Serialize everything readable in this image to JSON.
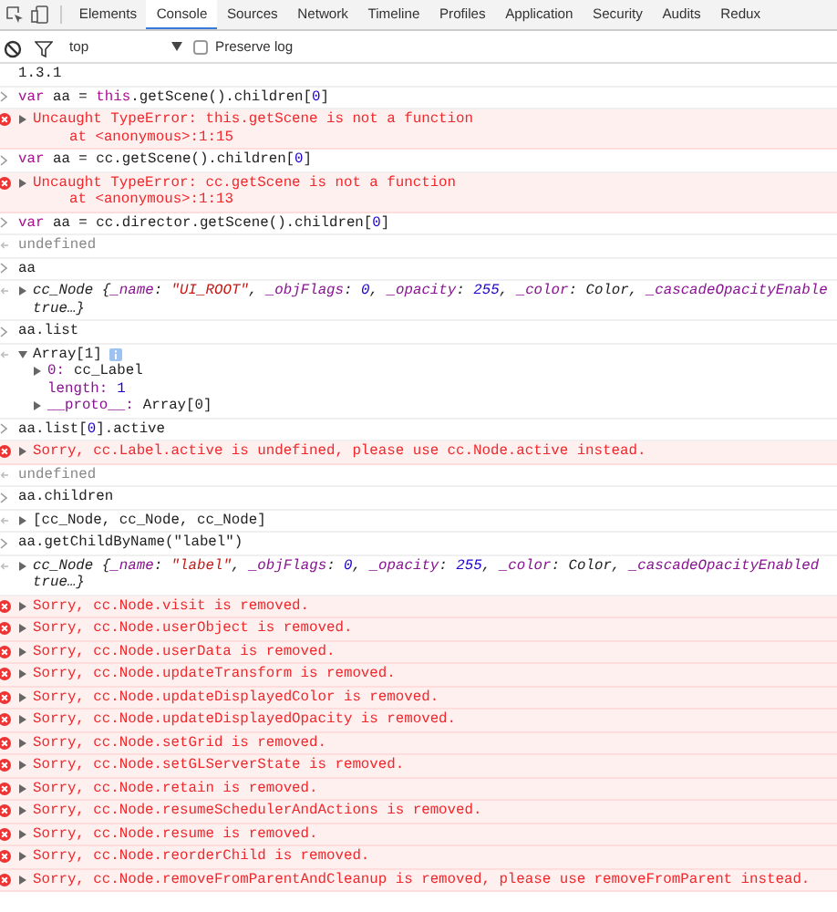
{
  "tabs": [
    {
      "label": "Elements",
      "selected": false
    },
    {
      "label": "Console",
      "selected": true
    },
    {
      "label": "Sources",
      "selected": false
    },
    {
      "label": "Network",
      "selected": false
    },
    {
      "label": "Timeline",
      "selected": false
    },
    {
      "label": "Profiles",
      "selected": false
    },
    {
      "label": "Application",
      "selected": false
    },
    {
      "label": "Security",
      "selected": false
    },
    {
      "label": "Audits",
      "selected": false
    },
    {
      "label": "Redux",
      "selected": false
    }
  ],
  "filter_bar": {
    "context": "top",
    "preserve_log": {
      "label": "Preserve log",
      "checked": false
    }
  },
  "console": [
    {
      "kind": "log",
      "text": "1.3.1"
    },
    {
      "kind": "input",
      "tokens": [
        {
          "kind": "keyword",
          "text": "var"
        },
        {
          "kind": "plain",
          "text": " aa = "
        },
        {
          "kind": "keyword",
          "text": "this"
        },
        {
          "kind": "plain",
          "text": ".getScene().children["
        },
        {
          "kind": "number",
          "text": "0"
        },
        {
          "kind": "plain",
          "text": "]"
        }
      ]
    },
    {
      "kind": "error",
      "expandable": true,
      "text": "Uncaught TypeError: this.getScene is not a function",
      "detail": "at <anonymous>:1:15"
    },
    {
      "kind": "input",
      "tokens": [
        {
          "kind": "keyword",
          "text": "var"
        },
        {
          "kind": "plain",
          "text": " aa = cc.getScene().children["
        },
        {
          "kind": "number",
          "text": "0"
        },
        {
          "kind": "plain",
          "text": "]"
        }
      ]
    },
    {
      "kind": "error",
      "expandable": true,
      "text": "Uncaught TypeError: cc.getScene is not a function",
      "detail": "at <anonymous>:1:13"
    },
    {
      "kind": "input",
      "tokens": [
        {
          "kind": "keyword",
          "text": "var"
        },
        {
          "kind": "plain",
          "text": " aa = cc.director.getScene().children["
        },
        {
          "kind": "number",
          "text": "0"
        },
        {
          "kind": "plain",
          "text": "]"
        }
      ]
    },
    {
      "kind": "output",
      "expandable": false,
      "text": "undefined"
    },
    {
      "kind": "input",
      "tokens": [
        {
          "kind": "plain",
          "text": "aa"
        }
      ]
    },
    {
      "kind": "object",
      "expandable": true,
      "lines": [
        [
          {
            "kind": "type",
            "text": "cc_Node {"
          },
          {
            "kind": "key",
            "text": "_name"
          },
          {
            "kind": "type",
            "text": ": "
          },
          {
            "kind": "string",
            "text": "\"UI_ROOT\""
          },
          {
            "kind": "type",
            "text": ", "
          },
          {
            "kind": "key",
            "text": "_objFlags"
          },
          {
            "kind": "type",
            "text": ": "
          },
          {
            "kind": "number",
            "text": "0"
          },
          {
            "kind": "type",
            "text": ", "
          },
          {
            "kind": "key",
            "text": "_opacity"
          },
          {
            "kind": "type",
            "text": ": "
          },
          {
            "kind": "number",
            "text": "255"
          },
          {
            "kind": "type",
            "text": ", "
          },
          {
            "kind": "key",
            "text": "_color"
          },
          {
            "kind": "type",
            "text": ": Color, "
          },
          {
            "kind": "key",
            "text": "_cascadeOpacityEnable"
          }
        ],
        [
          {
            "kind": "type",
            "text": "true…}"
          }
        ]
      ]
    },
    {
      "kind": "input",
      "tokens": [
        {
          "kind": "plain",
          "text": "aa.list"
        }
      ]
    },
    {
      "kind": "tree",
      "label": "Array[1]",
      "expanded": true,
      "children": [
        {
          "key": "0:",
          "value": "cc_Label",
          "expandable": true
        },
        {
          "key": "length:",
          "value": "1",
          "expandable": false
        },
        {
          "key": "__proto__:",
          "value": "Array[0]",
          "expandable": true
        }
      ]
    },
    {
      "kind": "input",
      "tokens": [
        {
          "kind": "plain",
          "text": "aa.list["
        },
        {
          "kind": "number",
          "text": "0"
        },
        {
          "kind": "plain",
          "text": "].active"
        }
      ]
    },
    {
      "kind": "error",
      "expandable": true,
      "text": "Sorry, cc.Label.active is undefined, please use cc.Node.active instead."
    },
    {
      "kind": "output",
      "expandable": false,
      "text": "undefined"
    },
    {
      "kind": "input",
      "tokens": [
        {
          "kind": "plain",
          "text": "aa.children"
        }
      ]
    },
    {
      "kind": "output",
      "expandable": true,
      "text": "[cc_Node, cc_Node, cc_Node]"
    },
    {
      "kind": "input",
      "tokens": [
        {
          "kind": "plain",
          "text": "aa.getChildByName(\"label\")"
        }
      ]
    },
    {
      "kind": "object",
      "expandable": true,
      "lines": [
        [
          {
            "kind": "type",
            "text": "cc_Node {"
          },
          {
            "kind": "key",
            "text": "_name"
          },
          {
            "kind": "type",
            "text": ": "
          },
          {
            "kind": "string",
            "text": "\"label\""
          },
          {
            "kind": "type",
            "text": ", "
          },
          {
            "kind": "key",
            "text": "_objFlags"
          },
          {
            "kind": "type",
            "text": ": "
          },
          {
            "kind": "number",
            "text": "0"
          },
          {
            "kind": "type",
            "text": ", "
          },
          {
            "kind": "key",
            "text": "_opacity"
          },
          {
            "kind": "type",
            "text": ": "
          },
          {
            "kind": "number",
            "text": "255"
          },
          {
            "kind": "type",
            "text": ", "
          },
          {
            "kind": "key",
            "text": "_color"
          },
          {
            "kind": "type",
            "text": ": Color, "
          },
          {
            "kind": "key",
            "text": "_cascadeOpacityEnabled"
          }
        ],
        [
          {
            "kind": "type",
            "text": "true…}"
          }
        ]
      ]
    },
    {
      "kind": "error",
      "expandable": true,
      "text": "Sorry, cc.Node.visit is removed."
    },
    {
      "kind": "error",
      "expandable": true,
      "text": "Sorry, cc.Node.userObject is removed."
    },
    {
      "kind": "error",
      "expandable": true,
      "text": "Sorry, cc.Node.userData is removed."
    },
    {
      "kind": "error",
      "expandable": true,
      "text": "Sorry, cc.Node.updateTransform is removed."
    },
    {
      "kind": "error",
      "expandable": true,
      "text": "Sorry, cc.Node.updateDisplayedColor is removed."
    },
    {
      "kind": "error",
      "expandable": true,
      "text": "Sorry, cc.Node.updateDisplayedOpacity is removed."
    },
    {
      "kind": "error",
      "expandable": true,
      "text": "Sorry, cc.Node.setGrid is removed."
    },
    {
      "kind": "error",
      "expandable": true,
      "text": "Sorry, cc.Node.setGLServerState is removed."
    },
    {
      "kind": "error",
      "expandable": true,
      "text": "Sorry, cc.Node.retain is removed."
    },
    {
      "kind": "error",
      "expandable": true,
      "text": "Sorry, cc.Node.resumeSchedulerAndActions is removed."
    },
    {
      "kind": "error",
      "expandable": true,
      "text": "Sorry, cc.Node.resume is removed."
    },
    {
      "kind": "error",
      "expandable": true,
      "text": "Sorry, cc.Node.reorderChild is removed."
    },
    {
      "kind": "error",
      "expandable": true,
      "text": "Sorry, cc.Node.removeFromParentAndCleanup is removed, please use removeFromParent instead."
    }
  ]
}
